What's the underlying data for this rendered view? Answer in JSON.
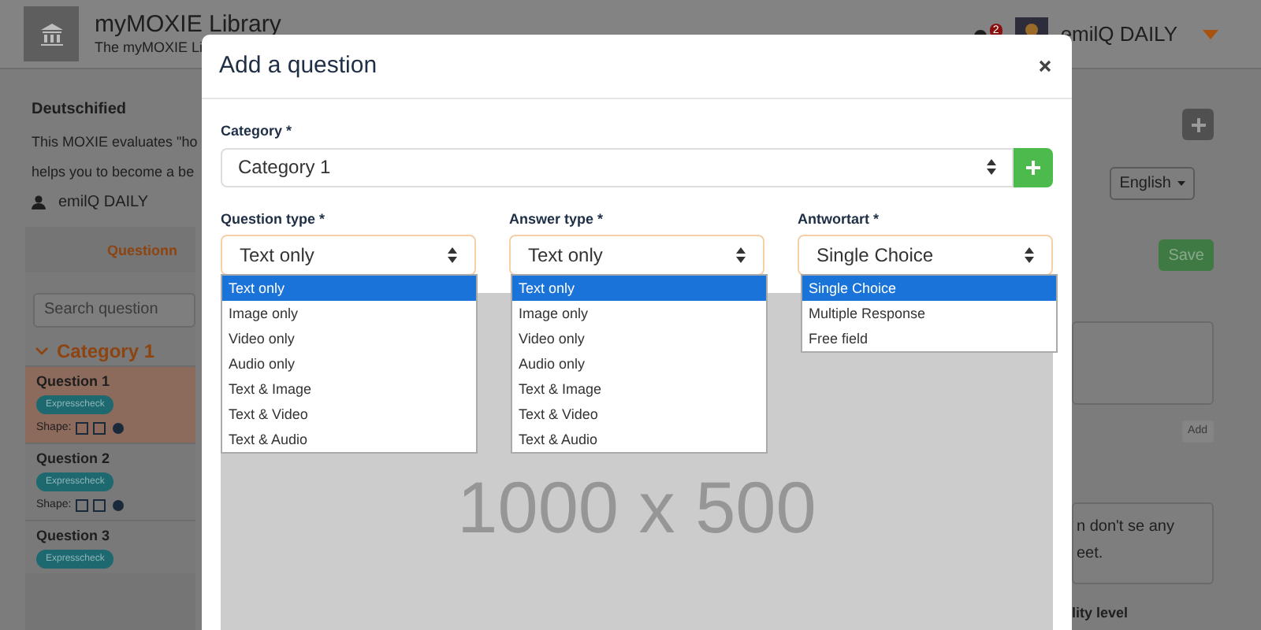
{
  "header": {
    "title": "myMOXIE Library",
    "subtitle": "The myMOXIE Li",
    "notification_count": "2",
    "user": "emilQ DAILY"
  },
  "moxie": {
    "title": "Deutschified",
    "description_lines": [
      "This MOXIE evaluates \"ho",
      "helps you to become a be"
    ],
    "author": "emilQ DAILY"
  },
  "sidebar": {
    "tab": "Questionn",
    "search_placeholder": "Search question",
    "category": "Category 1",
    "expanded": true,
    "questions": [
      {
        "title": "Question 1",
        "tag": "Expresscheck",
        "shape_label": "Shape:",
        "selected": true
      },
      {
        "title": "Question 2",
        "tag": "Expresscheck",
        "shape_label": "Shape:",
        "selected": false
      },
      {
        "title": "Question 3",
        "tag": "Expresscheck",
        "selected": false
      }
    ]
  },
  "right_panel": {
    "language": "English",
    "save": "Save",
    "add": "Add",
    "answer_lines": [
      "n don't se any",
      "eet."
    ],
    "level_label": "lity level"
  },
  "modal": {
    "title": "Add a question",
    "category_label": "Category *",
    "category_value": "Category 1",
    "selects": [
      {
        "label": "Question type *",
        "value": "Text only",
        "options": [
          {
            "label": "Text only",
            "selected": true
          },
          {
            "label": "Image only",
            "selected": false
          },
          {
            "label": "Video only",
            "selected": false
          },
          {
            "label": "Audio only",
            "selected": false
          },
          {
            "label": "Text & Image",
            "selected": false
          },
          {
            "label": "Text & Video",
            "selected": false
          },
          {
            "label": "Text & Audio",
            "selected": false
          }
        ]
      },
      {
        "label": "Answer type *",
        "value": "Text only",
        "options": [
          {
            "label": "Text only",
            "selected": true
          },
          {
            "label": "Image only",
            "selected": false
          },
          {
            "label": "Video only",
            "selected": false
          },
          {
            "label": "Audio only",
            "selected": false
          },
          {
            "label": "Text & Image",
            "selected": false
          },
          {
            "label": "Text & Video",
            "selected": false
          },
          {
            "label": "Text & Audio",
            "selected": false
          }
        ]
      },
      {
        "label": "Antwortart *",
        "value": "Single Choice",
        "options": [
          {
            "label": "Single Choice",
            "selected": true
          },
          {
            "label": "Multiple Response",
            "selected": false
          },
          {
            "label": "Free field",
            "selected": false
          }
        ]
      }
    ],
    "image_placeholder": "1000 x 500"
  }
}
